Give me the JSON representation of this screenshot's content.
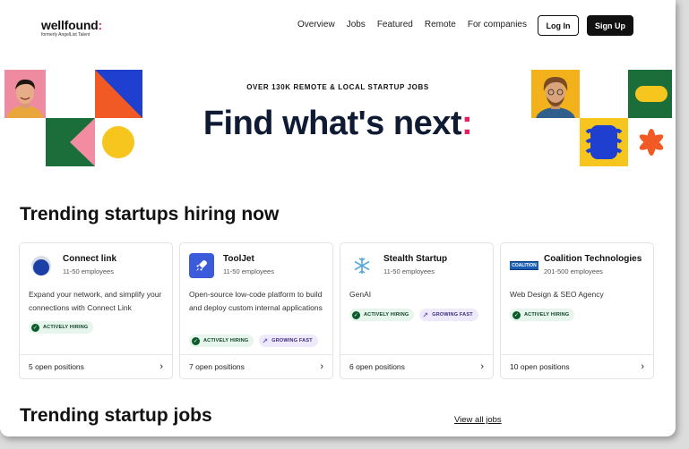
{
  "header": {
    "logo": "wellfound",
    "logo_colon": ":",
    "logo_sub": "formerly AngelList Talent",
    "nav": [
      "Overview",
      "Jobs",
      "Featured",
      "Remote",
      "For companies"
    ],
    "login": "Log In",
    "signup": "Sign Up"
  },
  "hero": {
    "eyebrow": "OVER 130K REMOTE & LOCAL STARTUP JOBS",
    "title": "Find what's next",
    "title_colon": ":"
  },
  "trending_startups": {
    "title": "Trending startups hiring now",
    "cards": [
      {
        "name": "Connect link",
        "size": "11-50 employees",
        "description": "Expand your network, and simplify your connections with Connect Link",
        "badges": [
          "ACTIVELY HIRING"
        ],
        "positions": "5 open positions",
        "logo_icon": "connect-link-logo"
      },
      {
        "name": "ToolJet",
        "size": "11-50 employees",
        "description": "Open-source low-code platform to build and deploy custom internal applications",
        "badges": [
          "ACTIVELY HIRING",
          "GROWING FAST"
        ],
        "positions": "7 open positions",
        "logo_icon": "rocket-icon"
      },
      {
        "name": "Stealth Startup",
        "size": "11-50 employees",
        "description": "GenAI",
        "badges": [
          "ACTIVELY HIRING",
          "GROWING FAST"
        ],
        "positions": "6 open positions",
        "logo_icon": "snowflake-icon"
      },
      {
        "name": "Coalition Technologies",
        "size": "201-500 employees",
        "description": "Web Design & SEO Agency",
        "badges": [
          "ACTIVELY HIRING"
        ],
        "positions": "10 open positions",
        "logo_icon": "coalition-logo",
        "logo_text": "COALITION"
      }
    ]
  },
  "trending_jobs": {
    "title": "Trending startup jobs",
    "view_all": "View all jobs"
  },
  "colors": {
    "accent": "#e0245e",
    "hero_title": "#0f1a33",
    "badge_hiring_bg": "#e6f6ec",
    "badge_growing_bg": "#efeafb"
  }
}
